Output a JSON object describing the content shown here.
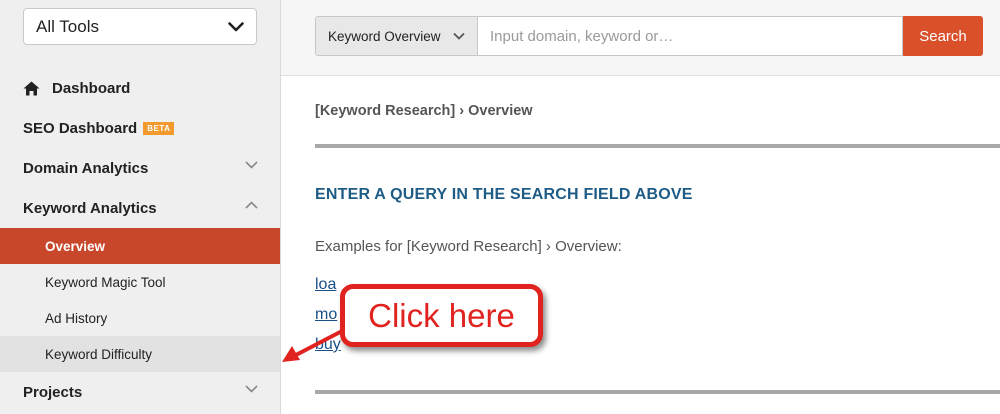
{
  "sidebar": {
    "tools_select": {
      "label": "All Tools"
    },
    "items": [
      {
        "label": "Dashboard",
        "icon": "home-icon"
      },
      {
        "label": "SEO Dashboard",
        "badge": "BETA"
      },
      {
        "label": "Domain Analytics",
        "icon": "chevron-down-icon"
      },
      {
        "label": "Keyword Analytics",
        "icon": "chevron-up-icon"
      }
    ],
    "sub_items": [
      {
        "label": "Overview",
        "active": true
      },
      {
        "label": "Keyword Magic Tool"
      },
      {
        "label": "Ad History"
      },
      {
        "label": "Keyword Difficulty"
      }
    ],
    "projects": {
      "label": "Projects",
      "icon": "chevron-down-icon"
    }
  },
  "search": {
    "mode_label": "Keyword Overview",
    "placeholder": "Input domain, keyword or…",
    "button_label": "Search"
  },
  "main": {
    "breadcrumb": "[Keyword Research] › Overview",
    "heading": "ENTER A QUERY IN THE SEARCH FIELD ABOVE",
    "examples_label": "Examples for [Keyword Research] › Overview:",
    "example_links": [
      "loa",
      "mo",
      "buy"
    ]
  },
  "annotation": {
    "text": "Click here"
  },
  "colors": {
    "accent": "#c8472b",
    "search_button": "#d9502b",
    "heading": "#1e5c86",
    "callout": "#e0231f"
  }
}
